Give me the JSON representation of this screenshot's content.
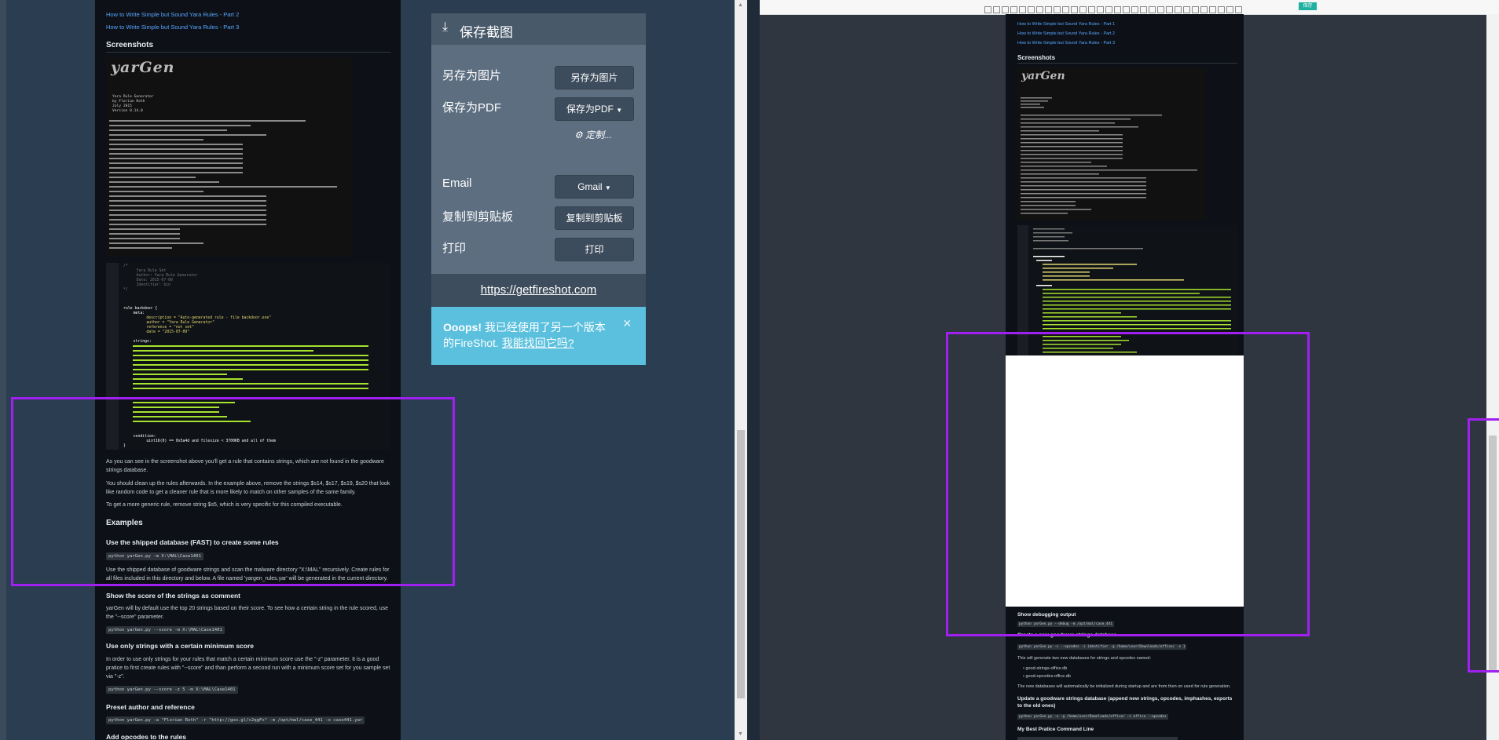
{
  "left_doc": {
    "links": [
      "How to Write Simple but Sound Yara Rules - Part 2",
      "How to Write Simple but Sound Yara Rules - Part 3"
    ],
    "screenshots_heading": "Screenshots",
    "terminal_lines": [
      "Yara Rule Generator",
      "by Florian Roth",
      "July 2015",
      "Version 0.14.0"
    ],
    "code_lines": [
      "/*",
      "   Yara Rule Set",
      "   Author: Yara Rule Generator",
      "   Date: 2015-07-09",
      "   Identifier: bin",
      "*/",
      "rule backdoor {",
      "   meta:",
      "      description = \"Auto-generated rule - file backdoor.exe\"",
      "      author = \"Yara Rule Generator\"",
      "      reference = \"not set\"",
      "      date = \"2015-07-09\"",
      "   strings:",
      "   condition:",
      "      uint16(0) == 0x5a4d and filesize < 3700KB and all of them",
      "}"
    ],
    "para1": "As you can see in the screenshot above you'll get a rule that contains strings, which are not found in the goodware strings database.",
    "para2": "You should clean up the rules afterwards. In the example above, remove the strings $s14, $s17, $s19, $s20 that look like random code to get a cleaner rule that is more likely to match on other samples of the same family.",
    "para3": "To get a more generic rule, remove string $s5, which is very specific for this compiled executable.",
    "examples_heading": "Examples",
    "ex1_title": "Use the shipped database (FAST) to create some rules",
    "ex1_code": "python yarGen.py -m X:\\MAL\\Case1401",
    "ex1_text": "Use the shipped database of goodware strings and scan the malware directory \"X:\\MAL\" recursively. Create rules for all files included in this directory and below. A file named 'yargen_rules.yar' will be generated in the current directory.",
    "ex2_title": "Show the score of the strings as comment",
    "ex2_text": "yarGen will by default use the top 20 strings based on their score. To see how a certain string in the rule scored, use the \"--score\" parameter.",
    "ex2_code": "python yarGen.py --score -m X:\\MAL\\Case1401",
    "ex3_title": "Use only strings with a certain minimum score",
    "ex3_text": "In order to use only strings for your rules that match a certain minimum score use the \"-z\" parameter. It is a good pratice to first create rules with \"--score\" and than perform a second run with a minimum score set for you sample set via \"-z\".",
    "ex3_code": "python yarGen.py --score -z 5 -m X:\\MAL\\Case1401",
    "ex4_title": "Preset author and reference",
    "ex4_code": "python yarGen.py -a \"Florian Roth\" -r \"http://goo.gl/c2qgFx\" -m /opt/mal/case_441 -o case441.yar",
    "ex5_title": "Add opcodes to the rules"
  },
  "fireshot": {
    "header_title": "保存截图",
    "save_image_label": "另存为图片",
    "save_image_button": "另存为图片",
    "save_pdf_label": "保存为PDF",
    "save_pdf_button": "保存为PDF",
    "customize": "定制...",
    "email_label": "Email",
    "email_button": "Gmail",
    "copy_label": "复制到剪贴板",
    "copy_button": "复制到剪贴板",
    "print_label": "打印",
    "print_button": "打印",
    "site_link": "https://getfireshot.com",
    "alert_bold": "Ooops!",
    "alert_text": "我已经使用了另一个版本的FireShot.",
    "alert_link": "我能找回它吗?",
    "close": "×"
  },
  "right_doc": {
    "links": [
      "How to Write Simple but Sound Yara Rules - Part 1",
      "How to Write Simple but Sound Yara Rules - Part 2",
      "How to Write Simple but Sound Yara Rules - Part 3"
    ],
    "screenshots_heading": "Screenshots",
    "debug_heading": "Show debugging output",
    "debug_code": "python yarGen.py --debug -m /opt/mal/case_441",
    "new_db_heading": "Create a new goodware strings database",
    "new_db_code": "python yarGen.py -c --opcodes -i identifier -g /home/user/Downloads/office/ -s 1",
    "new_db_text": "This will generate two new databases for strings and opcodes named:",
    "bullets": [
      "good-strings-office.db",
      "good-opcodes-office.db"
    ],
    "new_db_note": "The new databases will automatically be initialized during startup and are from then on used for rule generation.",
    "update_heading": "Update a goodware strings database (append new strings, opcodes, imphashes, exports to the old ones)",
    "update_code": "python yarGen.py -u -g /home/user/Downloads/office/ -i office --opcodes",
    "best_heading": "My Best Pratice Command Line"
  },
  "toolbar_badge": "保存"
}
